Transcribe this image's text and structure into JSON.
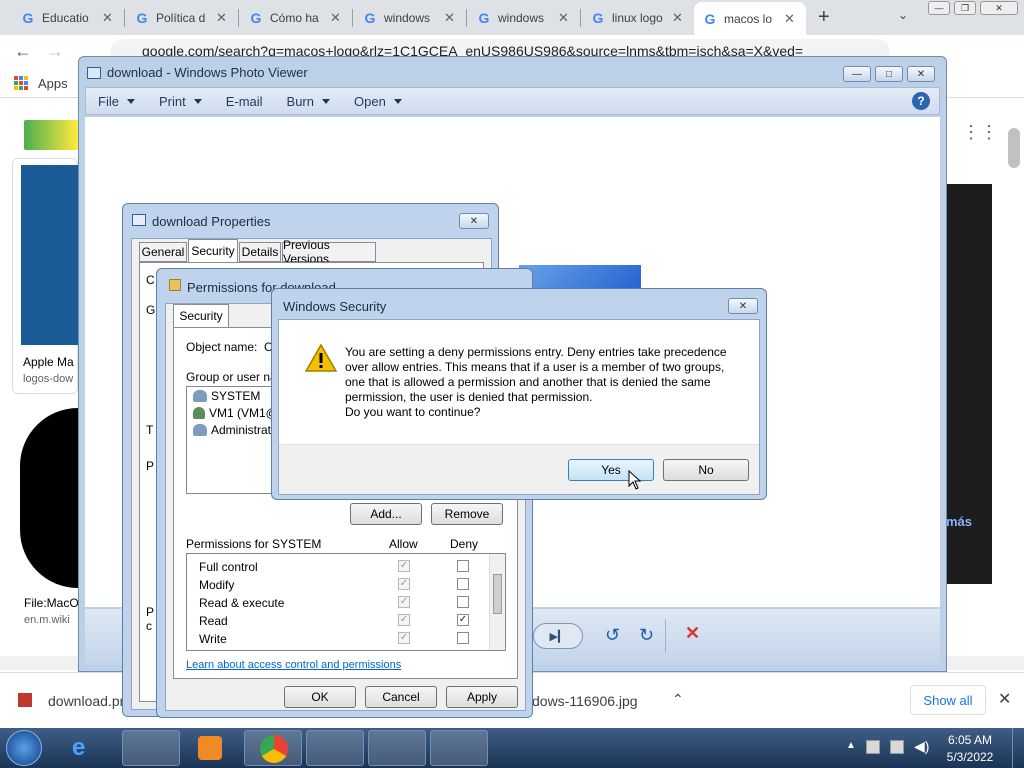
{
  "browser": {
    "tabs": [
      {
        "title": "Educatio"
      },
      {
        "title": "Política d"
      },
      {
        "title": "Cómo ha"
      },
      {
        "title": "windows"
      },
      {
        "title": "windows"
      },
      {
        "title": "linux logo"
      },
      {
        "title": "macos lo"
      }
    ],
    "url": "google.com/search?q=macos+logo&rlz=1C1GCEA_enUS986US986&source=lnms&tbm=isch&sa=X&ved=",
    "apps_label": "Apps"
  },
  "background": {
    "card1_title": "Apple Ma",
    "card1_source": "logos-dow",
    "card2_title": "File:MacO",
    "card2_source": "en.m.wiki",
    "mas_text": "más"
  },
  "photo_viewer": {
    "title": "download - Windows Photo Viewer",
    "menu": [
      "File",
      "Print",
      "E-mail",
      "Burn",
      "Open"
    ],
    "help": "?"
  },
  "properties": {
    "title": "download Properties",
    "tabs": [
      "General",
      "Security",
      "Details",
      "Previous Versions"
    ],
    "fragments": [
      "C",
      "G",
      "T",
      "P",
      "P",
      "c"
    ]
  },
  "permissions": {
    "title": "Permissions for download",
    "tab": "Security",
    "object_name_label": "Object name:",
    "object_name_value": "C",
    "group_label": "Group or user nam",
    "users": [
      "SYSTEM",
      "VM1 (VM1@",
      "Administrators"
    ],
    "add_label": "Add...",
    "remove_label": "Remove",
    "perm_header": "Permissions for SYSTEM",
    "allow_label": "Allow",
    "deny_label": "Deny",
    "rows": [
      {
        "name": "Full control",
        "deny": false
      },
      {
        "name": "Modify",
        "deny": false
      },
      {
        "name": "Read & execute",
        "deny": false
      },
      {
        "name": "Read",
        "deny": true
      },
      {
        "name": "Write",
        "deny": false
      }
    ],
    "link": "Learn about access control and permissions",
    "ok": "OK",
    "cancel": "Cancel",
    "apply": "Apply"
  },
  "security_dialog": {
    "title": "Windows Security",
    "message": "You are setting a deny permissions entry. Deny entries take precedence over allow entries. This means that if a user is a member of two groups, one that is allowed a permission and another that is denied the same permission, the user is denied that permission.",
    "question": "Do you want to continue?",
    "yes": "Yes",
    "no": "No"
  },
  "downloads": {
    "file1": "download.pn",
    "file2": "dows-116906.jpg",
    "show_all": "Show all"
  },
  "taskbar": {
    "time": "6:05 AM",
    "date": "5/3/2022"
  },
  "colors": {
    "accent": "#4285f4",
    "photo_viewer_frame": "#bcd0e8",
    "taskbar": "#1c3455",
    "close_red": "#d9342b"
  }
}
